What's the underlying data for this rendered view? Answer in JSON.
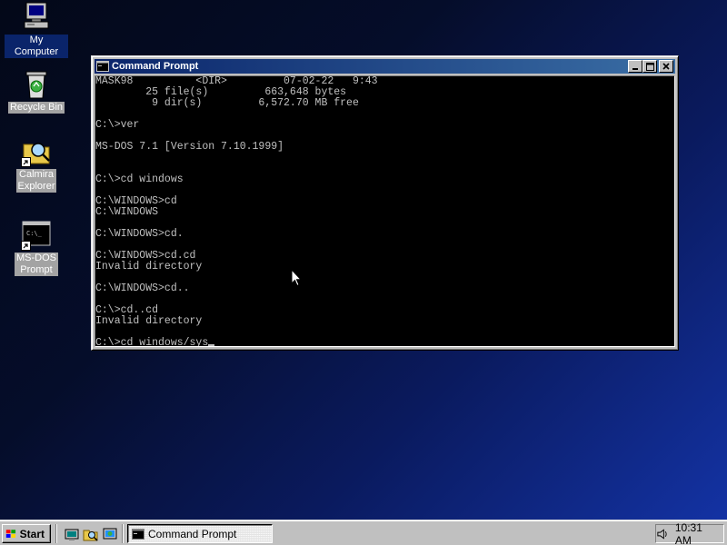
{
  "desktop": {
    "icons": [
      {
        "label": "My Computer",
        "icon": "computer-icon"
      },
      {
        "label": "Recycle Bin",
        "icon": "recycle-bin-icon"
      },
      {
        "label": "Calmira\nExplorer",
        "icon": "folder-search-icon"
      },
      {
        "label": "MS-DOS\nPrompt",
        "icon": "msdos-icon"
      }
    ]
  },
  "window": {
    "title": "Command Prompt",
    "console_lines": [
      "MASK98          <DIR>         07-02-22   9:43",
      "        25 file(s)         663,648 bytes",
      "         9 dir(s)         6,572.70 MB free",
      "",
      "C:\\>ver",
      "",
      "MS-DOS 7.1 [Version 7.10.1999]",
      "",
      "",
      "C:\\>cd windows",
      "",
      "C:\\WINDOWS>cd",
      "C:\\WINDOWS",
      "",
      "C:\\WINDOWS>cd.",
      "",
      "C:\\WINDOWS>cd.cd",
      "Invalid directory",
      "",
      "C:\\WINDOWS>cd..",
      "",
      "C:\\>cd..cd",
      "Invalid directory",
      ""
    ],
    "prompt_line": "C:\\>cd windows/sys"
  },
  "taskbar": {
    "start_label": "Start",
    "task_label": "Command Prompt",
    "clock": "10:31 AM"
  },
  "colors": {
    "title_active": "#0a246a",
    "title_active_end": "#3a6ea5",
    "console_bg": "#000000",
    "console_fg": "#c0c0c0",
    "chrome": "#c0c0c0"
  }
}
